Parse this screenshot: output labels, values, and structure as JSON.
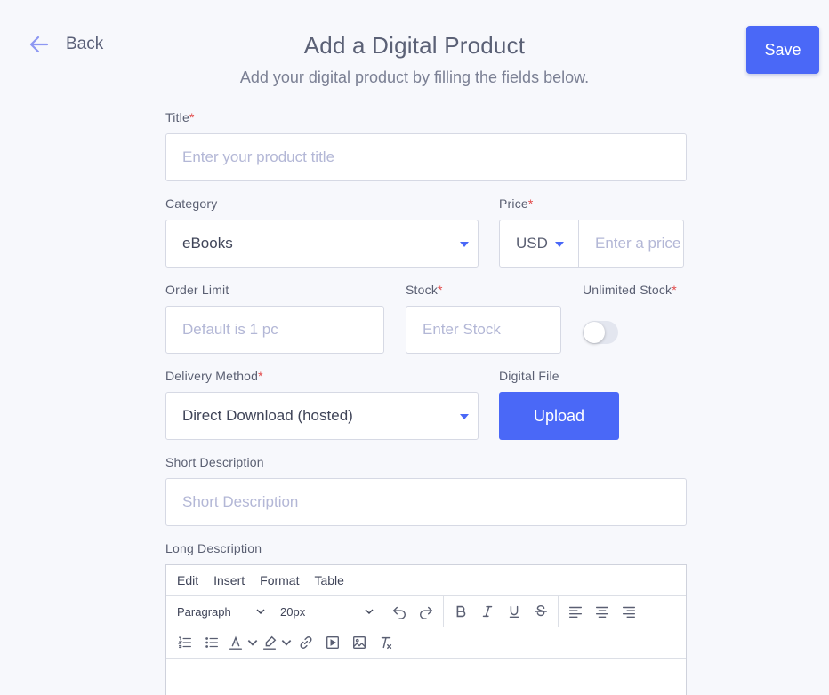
{
  "nav": {
    "back_label": "Back"
  },
  "header": {
    "title": "Add a Digital Product",
    "subtitle": "Add your digital product by filling the fields below."
  },
  "actions": {
    "save_label": "Save",
    "upload_label": "Upload"
  },
  "form": {
    "title": {
      "label": "Title",
      "required": "*",
      "placeholder": "Enter your product title"
    },
    "category": {
      "label": "Category",
      "value": "eBooks"
    },
    "price": {
      "label": "Price",
      "required": "*",
      "currency": "USD",
      "placeholder": "Enter a price"
    },
    "order_limit": {
      "label": "Order Limit",
      "placeholder": "Default is 1 pc"
    },
    "stock": {
      "label": "Stock",
      "required": "*",
      "placeholder": "Enter Stock"
    },
    "unlimited_stock": {
      "label": "Unlimited Stock",
      "required": "*",
      "enabled": false
    },
    "delivery_method": {
      "label": "Delivery Method",
      "required": "*",
      "value": "Direct Download (hosted)"
    },
    "digital_file": {
      "label": "Digital File"
    },
    "short_description": {
      "label": "Short Description",
      "placeholder": "Short Description"
    },
    "long_description": {
      "label": "Long Description"
    }
  },
  "editor": {
    "menu": [
      "Edit",
      "Insert",
      "Format",
      "Table"
    ],
    "block_format": "Paragraph",
    "font_size": "20px"
  },
  "colors": {
    "accent": "#4a68f7",
    "required": "#e24a4a",
    "placeholder": "#b3b7d6"
  }
}
